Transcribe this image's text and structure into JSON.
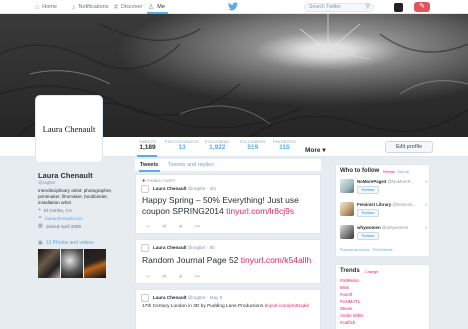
{
  "nav": {
    "home": "Home",
    "notifications": "Notifications",
    "discover": "Discover",
    "me": "Me",
    "search_placeholder": "Search Twitter"
  },
  "profile": {
    "stats": [
      {
        "label": "TWEETS",
        "value": "1,189"
      },
      {
        "label": "PHOTOS/VIDEOS",
        "value": "13"
      },
      {
        "label": "FOLLOWING",
        "value": "1,922"
      },
      {
        "label": "FOLLOWERS",
        "value": "519"
      },
      {
        "label": "FAVORITES",
        "value": "115"
      }
    ],
    "more": "More ▾",
    "edit_profile": "Edit profile",
    "avatar_text": "Laura Chenault",
    "name": "Laura Chenault",
    "handle": "@ragtter",
    "bio": "Interdisciplinary artist: photographer, printmaker, filmmaker, bookbinder, installation artist",
    "location": "El Cerrito, CA",
    "website": "laurachenault.com",
    "joined": "Joined April 2009",
    "photos_label": "13 Photos and videos"
  },
  "tabs": {
    "tweets": "Tweets",
    "tweets_replies": "Tweets and replies"
  },
  "tweets": [
    {
      "pinned": "PINNED TWEET",
      "name": "Laura Chenault",
      "meta": "@ragtter · 4m",
      "text": "Happy Spring – 50% Everything! Just use coupon SPRING2014",
      "link": "tinyurl.com/lr8cj9s"
    },
    {
      "name": "Laura Chenault",
      "meta": "@ragtter · 8h",
      "text": "Random Journal Page 52",
      "link": "tinyurl.com/k54allh"
    },
    {
      "name": "Laura Chenault",
      "meta": "@ragtter · May 6",
      "text": "17th Century London in 3D by Pudding Lane Productions",
      "link": "tinyurl.com/pm6zqkd"
    }
  ],
  "who_to_follow": {
    "title": "Who to follow",
    "refresh": "Refresh",
    "view_all": "View all",
    "follow": "Follow",
    "suggestions": [
      {
        "name": "NoMorePage3",
        "handle": "@NoMoreP..."
      },
      {
        "name": "Feminist Library",
        "handle": "@feminist..."
      },
      {
        "name": "whywomen",
        "handle": "@whywomen"
      }
    ],
    "footer": "Popular accounts · Find friends"
  },
  "trends": {
    "title": "Trends",
    "change": "Change",
    "items": [
      "#IHMelon",
      "Mimi",
      "#oomf",
      "#UHMATL",
      "Stevie",
      "Andre Miller",
      "#catfish"
    ]
  }
}
